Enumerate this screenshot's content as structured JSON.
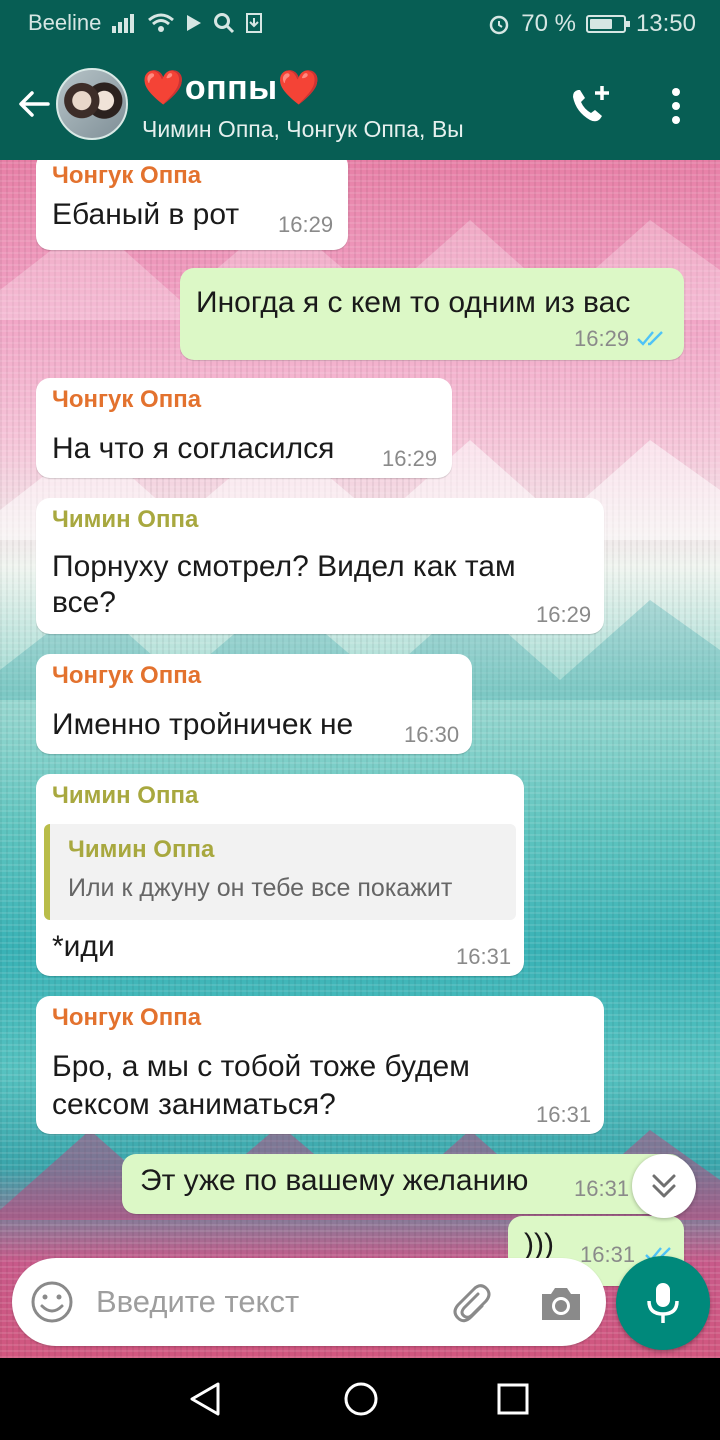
{
  "status_bar": {
    "carrier": "Beeline",
    "battery": "70 %",
    "battery_level": 0.7,
    "time": "13:50"
  },
  "header": {
    "title": "❤️оппы❤️",
    "subtitle": "Чимин Оппа, Чонгук Оппа, Вы"
  },
  "messages": [
    {
      "direction": "in",
      "sender": "Чонгук Оппа",
      "text": "Ебаный в рот",
      "time": "16:29"
    },
    {
      "direction": "out",
      "text": "Иногда я с кем то одним из вас",
      "time": "16:29",
      "read": true
    },
    {
      "direction": "in",
      "sender": "Чонгук Оппа",
      "text": "На что я согласился",
      "time": "16:29"
    },
    {
      "direction": "in",
      "sender": "Чимин Оппа",
      "text_line1": "Порнуху смотрел?  Видел как там",
      "text_line2": "все?",
      "time": "16:29"
    },
    {
      "direction": "in",
      "sender": "Чонгук Оппа",
      "text": "Именно тройничек не",
      "time": "16:30"
    },
    {
      "direction": "in",
      "sender": "Чимин Оппа",
      "quote": {
        "name": "Чимин Оппа",
        "text": "Или к джуну он тебе все покажит"
      },
      "text": "*иди",
      "time": "16:31"
    },
    {
      "direction": "in",
      "sender": "Чонгук Оппа",
      "text_line1": "Бро, а мы с тобой тоже будем",
      "text_line2": "сексом заниматься?",
      "time": "16:31"
    },
    {
      "direction": "out",
      "text": "Эт уже по вашему желанию",
      "time": "16:31"
    },
    {
      "direction": "out",
      "text": ")))",
      "time": "16:31"
    }
  ],
  "input": {
    "placeholder": "Введите текст"
  },
  "colors": {
    "header": "#075e54",
    "outgoing_bubble": "#dcf8c6",
    "sender_orange": "#e3722e",
    "sender_olive": "#a8a83f",
    "mic_button": "#00897b",
    "read_ticks": "#4fc3f7"
  },
  "icons": [
    "back-arrow-icon",
    "add-call-icon",
    "more-vert-icon",
    "emoji-icon",
    "paperclip-icon",
    "camera-icon",
    "microphone-icon",
    "scroll-down-icon",
    "nav-back-icon",
    "nav-home-icon",
    "nav-recent-icon"
  ]
}
